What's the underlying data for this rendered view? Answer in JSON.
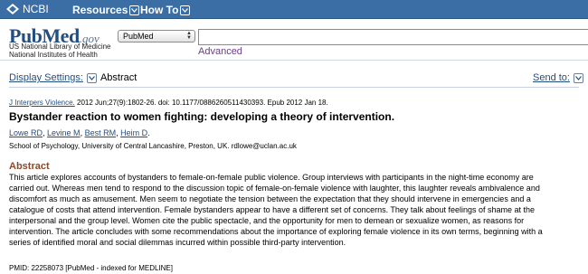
{
  "ncbi_bar": {
    "logo_text": "NCBI",
    "resources_label": "Resources",
    "howto_label": "How To"
  },
  "header": {
    "logo_pub": "Pub",
    "logo_med": "Med",
    "logo_gov": ".gov",
    "sub_line1": "US National Library of Medicine",
    "sub_line2": "National Institutes of Health",
    "database_selected": "PubMed",
    "search_value": "",
    "advanced_label": "Advanced"
  },
  "display": {
    "settings_label": "Display Settings:",
    "format_value": "Abstract",
    "send_to_label": "Send to:"
  },
  "article": {
    "journal": "J Interpers Violence.",
    "citation_rest": " 2012 Jun;27(9):1802-26. doi: 10.1177/0886260511430393. Epub 2012 Jan 18.",
    "title": "Bystander reaction to women fighting: developing a theory of intervention.",
    "authors": [
      "Lowe RD",
      "Levine M",
      "Best RM",
      "Heim D"
    ],
    "affiliation": "School of Psychology, University of Central Lancashire, Preston, UK. rdlowe@uclan.ac.uk",
    "abstract_heading": "Abstract",
    "abstract_lines": [
      "This article explores accounts of bystanders to female-on-female public violence. Group interviews with participants in the night-time economy are",
      "carried out. Whereas men tend to respond to the discussion topic of female-on-female violence with laughter, this laughter reveals ambivalence and",
      "discomfort as much as amusement. Men seem to negotiate the tension between the expectation that they should intervene in emergencies and a",
      "catalogue of costs that attend intervention. Female bystanders appear to have a different set of concerns. They talk about feelings of shame at the",
      "interpersonal and the group level. Women cite the public spectacle, and the opportunity for men to demean or sexualize women, as reasons for",
      "intervention. The article concludes with some recommendations about the importance of exploring female violence in its own terms, beginning with a",
      "series of identified moral and social dilemmas incurred within possible third-party intervention."
    ],
    "pmid_line": "PMID: 22258073 [PubMed - indexed for MEDLINE]"
  }
}
